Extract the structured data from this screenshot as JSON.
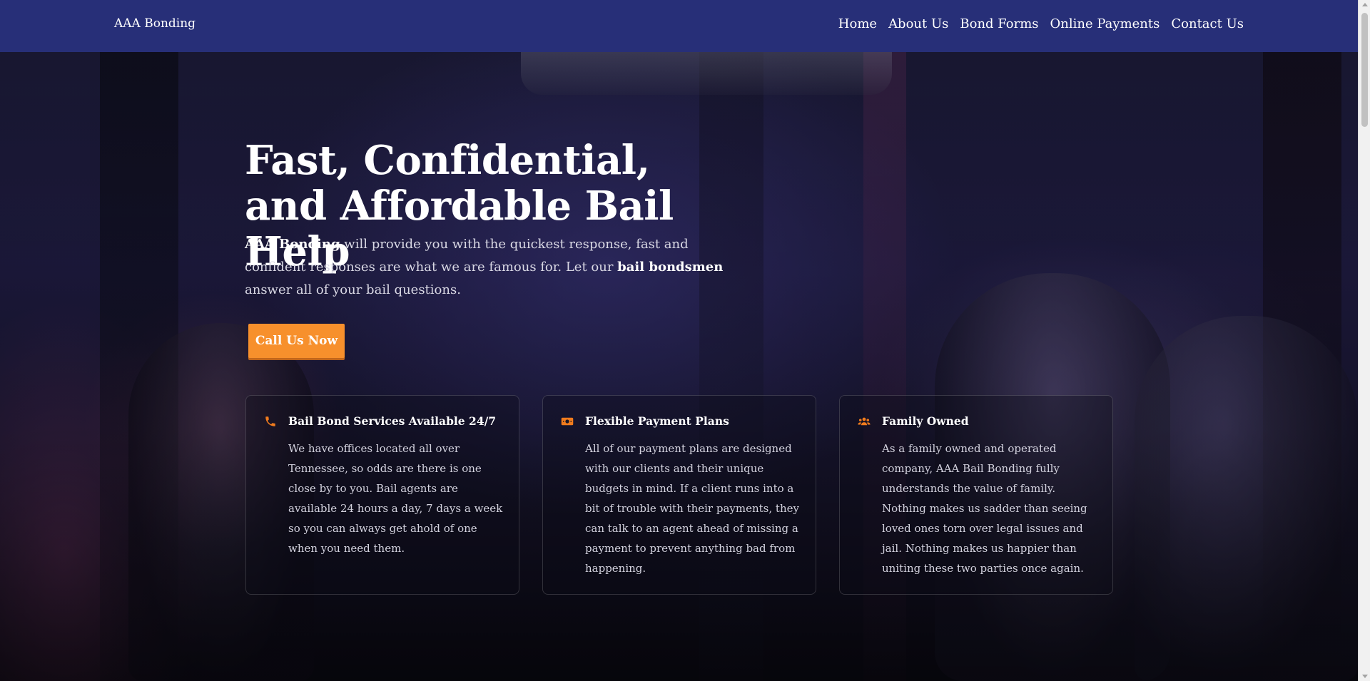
{
  "navbar": {
    "brand": "AAA Bonding",
    "links": [
      "Home",
      "About Us",
      "Bond Forms",
      "Online Payments",
      "Contact Us"
    ]
  },
  "hero": {
    "title": "Fast, Confidential, and Affordable Bail Help",
    "text_strong_1": "AAA Bonding",
    "text_part_1": " will provide you with the quickest response, fast and confident responses are what we are famous for. Let our ",
    "text_strong_2": "bail bondsmen",
    "text_part_2": " answer all of your bail questions.",
    "cta_label": "Call Us Now"
  },
  "cards": [
    {
      "icon": "phone-icon",
      "title": "Bail Bond Services Available 24/7",
      "text": "We have offices located all over Tennessee, so odds are there is one close by to you. Bail agents are available 24 hours a day, 7 days a week so you can always get ahold of one when you need them."
    },
    {
      "icon": "money-bill-icon",
      "title": "Flexible Payment Plans",
      "text": "All of our payment plans are designed with our clients and their unique budgets in mind. If a client runs into a bit of trouble with their payments, they can talk to an agent ahead of missing a payment to prevent anything bad from happening."
    },
    {
      "icon": "users-icon",
      "title": "Family Owned",
      "text": "As a family owned and operated company, AAA Bail Bonding fully understands the value of family. Nothing makes us sadder than seeing loved ones torn over legal issues and jail. Nothing makes us happier than uniting these two parties once again."
    }
  ],
  "colors": {
    "navbar": "#272f78",
    "accent": "#f7902c",
    "icon": "#f07b1d"
  }
}
